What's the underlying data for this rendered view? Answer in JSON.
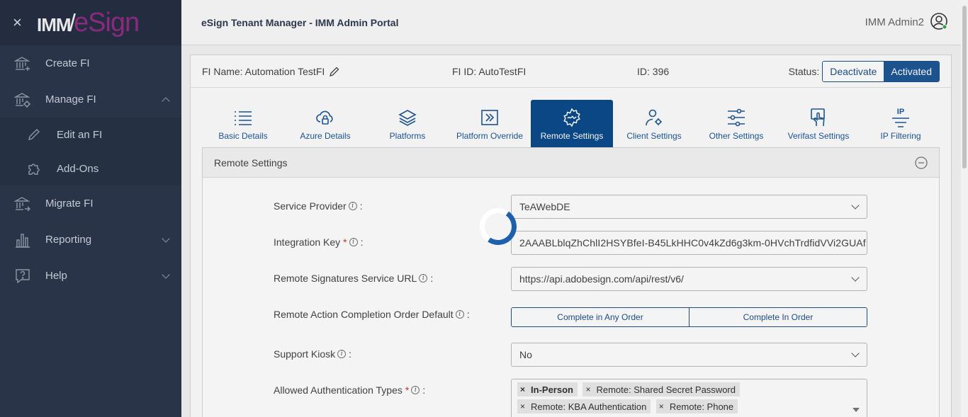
{
  "sidebar": {
    "close_symbol": "×",
    "logo": {
      "imm": "IMM",
      "slash": "/",
      "esign": "eSign"
    },
    "items": [
      {
        "label": "Create FI",
        "icon": "bank-plus-icon"
      },
      {
        "label": "Manage FI",
        "icon": "bank-gear-icon",
        "expanded": true,
        "children": [
          {
            "label": "Edit an FI",
            "icon": "pencil-icon"
          },
          {
            "label": "Add-Ons",
            "icon": "puzzle-icon"
          }
        ]
      },
      {
        "label": "Migrate FI",
        "icon": "bank-arrow-icon"
      },
      {
        "label": "Reporting",
        "icon": "bar-chart-icon"
      },
      {
        "label": "Help",
        "icon": "question-bubble-icon"
      }
    ]
  },
  "header": {
    "title": "eSign Tenant Manager - IMM Admin Portal",
    "user": "IMM Admin2"
  },
  "fi_info": {
    "name": "FI Name: Automation TestFI",
    "fi_id": "FI ID: AutoTestFI",
    "id": "ID: 396",
    "status_label": "Status:",
    "deactivate": "Deactivate",
    "activated": "Activated"
  },
  "tabs": [
    {
      "label": "Basic Details",
      "icon": "list-icon"
    },
    {
      "label": "Azure Details",
      "icon": "cloud-lock-icon"
    },
    {
      "label": "Platforms",
      "icon": "layers-icon"
    },
    {
      "label": "Platform Override",
      "icon": "override-icon"
    },
    {
      "label": "Remote Settings",
      "icon": "gear-signature-icon",
      "active": true
    },
    {
      "label": "Client Settings",
      "icon": "user-gear-icon"
    },
    {
      "label": "Other Settings",
      "icon": "sliders-icon"
    },
    {
      "label": "Verifast Settings",
      "icon": "hand-touch-icon"
    },
    {
      "label": "IP Filtering",
      "icon": "ip-filter-icon",
      "icon_text": "IP"
    }
  ],
  "panel": {
    "title": "Remote Settings",
    "fields": {
      "service_provider": {
        "label": "Service Provider",
        "value": "TeAWebDE"
      },
      "integration_key": {
        "label": "Integration Key",
        "value": "2AAABLblqZhChlI2HSYBfeI-B45LkHHC0v4kZd6g3km-0HVchTrdfidVVi2GUAf"
      },
      "service_url": {
        "label": "Remote Signatures Service URL",
        "value": "https://api.adobesign.com/api/rest/v6/"
      },
      "completion_order": {
        "label": "Remote Action Completion Order Default",
        "option_a": "Complete in Any Order",
        "option_b": "Complete In Order"
      },
      "support_kiosk": {
        "label": "Support Kiosk",
        "value": "No"
      },
      "auth_types": {
        "label": "Allowed Authentication Types",
        "chips": [
          "In-Person",
          "Remote: Shared Secret Password",
          "Remote: KBA Authentication",
          "Remote: Phone"
        ]
      }
    },
    "colon": ":",
    "required_mark": "*",
    "info_glyph": "i",
    "chip_remove": "×"
  },
  "colors": {
    "sidebar_bg": "#2a3448",
    "accent": "#1e5796",
    "active_tab": "#0d4b8c",
    "required": "#c0392b",
    "logo_esign": "#8a2a7e"
  }
}
